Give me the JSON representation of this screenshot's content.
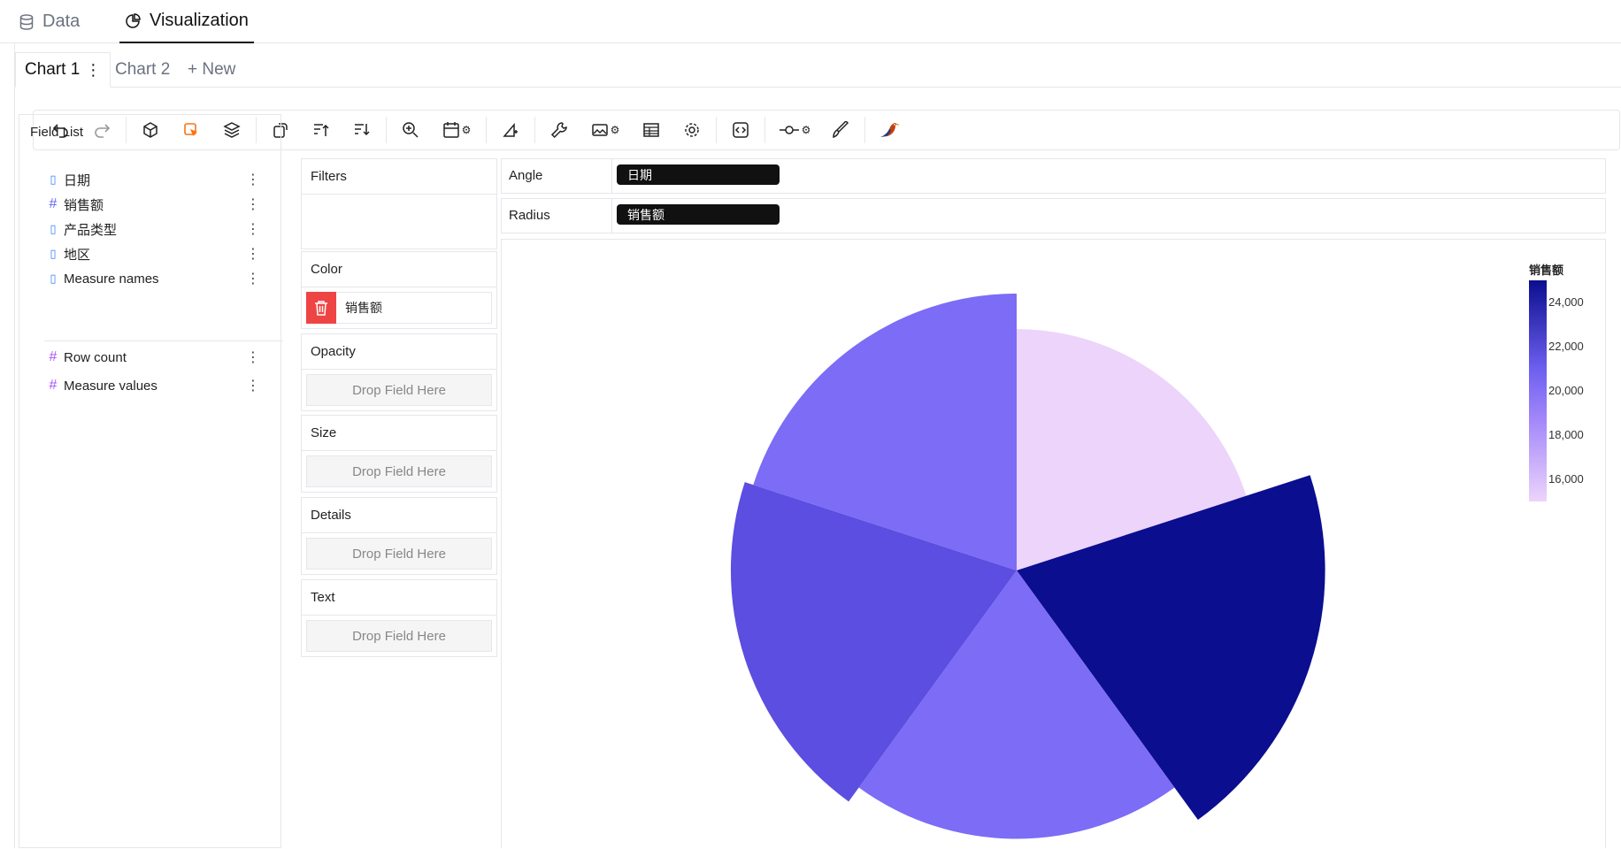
{
  "topnav": {
    "tabs": [
      {
        "label": "Data",
        "icon": "database-icon"
      },
      {
        "label": "Visualization",
        "icon": "pie-chart-icon"
      }
    ]
  },
  "chart_tabs": {
    "items": [
      "Chart 1",
      "Chart 2"
    ],
    "new_label": "+ New",
    "kebab": "⋮"
  },
  "field_list": {
    "title": "Field List",
    "dimensions": [
      {
        "label": "日期",
        "icon": "document-icon"
      },
      {
        "label": "销售额",
        "icon": "hash-icon"
      },
      {
        "label": "产品类型",
        "icon": "document-icon"
      },
      {
        "label": "地区",
        "icon": "document-icon"
      },
      {
        "label": "Measure names",
        "icon": "document-icon"
      }
    ],
    "measures": [
      {
        "label": "Row count",
        "icon": "hash-icon"
      },
      {
        "label": "Measure values",
        "icon": "hash-icon"
      }
    ],
    "menu_glyph": "⋮"
  },
  "encodings": {
    "filters": "Filters",
    "color": "Color",
    "color_field": "销售额",
    "opacity": "Opacity",
    "size": "Size",
    "details": "Details",
    "text": "Text",
    "drop_hint": "Drop Field Here"
  },
  "shelves": {
    "angle_label": "Angle",
    "angle_field": "日期",
    "radius_label": "Radius",
    "radius_field": "销售额"
  },
  "colors": {
    "accent": "#111111",
    "danger": "#ef4444",
    "color_scale": [
      "#ecd4fb",
      "#a78bfa",
      "#7c6cf6",
      "#5b4ee0",
      "#0b0e8f"
    ]
  },
  "chart_data": {
    "type": "pie",
    "variant": "rose",
    "theta_field": "日期",
    "radius_field": "销售额",
    "color_field": "销售额",
    "slices": [
      {
        "value": 15200
      },
      {
        "value": 24800
      },
      {
        "value": 18800
      },
      {
        "value": 21300
      },
      {
        "value": 20000
      }
    ],
    "legend": {
      "title": "销售额",
      "ticks": [
        "24,000",
        "22,000",
        "20,000",
        "18,000",
        "16,000"
      ],
      "min": 15000,
      "max": 25000,
      "position": "top-right"
    }
  }
}
